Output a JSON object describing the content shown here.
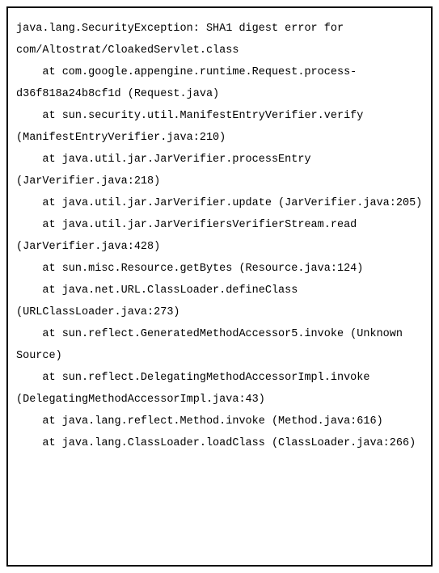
{
  "stacktrace": {
    "exception": "java.lang.SecurityException: SHA1 digest error for com/Altostrat/CloakedServlet.class",
    "frames": [
      "    at com.google.appengine.runtime.Request.process-d36f818a24b8cf1d (Request.java)",
      "    at sun.security.util.ManifestEntryVerifier.verify (ManifestEntryVerifier.java:210)",
      "    at java.util.jar.JarVerifier.processEntry (JarVerifier.java:218)",
      "    at java.util.jar.JarVerifier.update (JarVerifier.java:205)",
      "    at java.util.jar.JarVerifiersVerifierStream.read (JarVerifier.java:428)",
      "    at sun.misc.Resource.getBytes (Resource.java:124)",
      "    at java.net.URL.ClassLoader.defineClass (URLClassLoader.java:273)",
      "    at sun.reflect.GeneratedMethodAccessor5.invoke (Unknown Source)",
      "    at sun.reflect.DelegatingMethodAccessorImpl.invoke (DelegatingMethodAccessorImpl.java:43)",
      "    at java.lang.reflect.Method.invoke (Method.java:616)",
      "    at java.lang.ClassLoader.loadClass (ClassLoader.java:266)"
    ]
  }
}
